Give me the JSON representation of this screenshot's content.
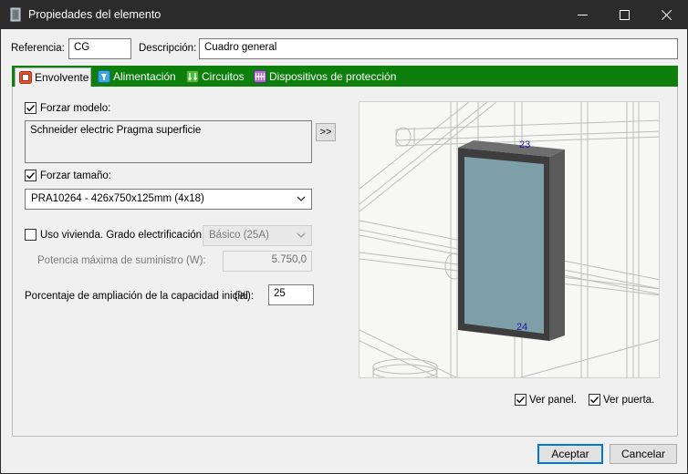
{
  "window": {
    "title": "Propiedades del elemento"
  },
  "header": {
    "referencia_label": "Referencia:",
    "referencia_value": "CG",
    "descripcion_label": "Descripción:",
    "descripcion_value": "Cuadro general"
  },
  "tabs": [
    {
      "label": "Envolvente",
      "icon": "enclosure-icon",
      "active": true
    },
    {
      "label": "Alimentación",
      "icon": "power-supply-icon",
      "active": false
    },
    {
      "label": "Circuitos",
      "icon": "circuits-icon",
      "active": false
    },
    {
      "label": "Dispositivos de protección",
      "icon": "protection-devices-icon",
      "active": false
    }
  ],
  "envolvente": {
    "forzar_modelo_label": "Forzar modelo:",
    "forzar_modelo_checked": true,
    "modelo_value": "Schneider electric Pragma superficie",
    "browse_label": ">>",
    "forzar_tamano_label": "Forzar tamaño:",
    "forzar_tamano_checked": true,
    "tamano_value": "PRA10264 - 426x750x125mm (4x18)",
    "uso_vivienda_label": "Uso vivienda. Grado electrificación:",
    "uso_vivienda_checked": false,
    "grado_value": "Básico (25A)",
    "potencia_label": "Potencia máxima de suministro (W):",
    "potencia_value": "5.750,0",
    "porcentaje_label": "Porcentaje de ampliación de la capacidad inicial",
    "porcentaje_unit": "(%):",
    "porcentaje_value": "25"
  },
  "preview": {
    "top_label": "23",
    "bottom_label": "24",
    "panel_color": "#7f9fa8"
  },
  "view_options": {
    "ver_panel_label": "Ver panel.",
    "ver_panel_checked": true,
    "ver_puerta_label": "Ver puerta.",
    "ver_puerta_checked": true
  },
  "footer": {
    "accept_label": "Aceptar",
    "cancel_label": "Cancelar"
  },
  "colors": {
    "tabbar": "#0d7f0d",
    "titlebar": "#2b2b2b",
    "accent": "#0078d7"
  }
}
